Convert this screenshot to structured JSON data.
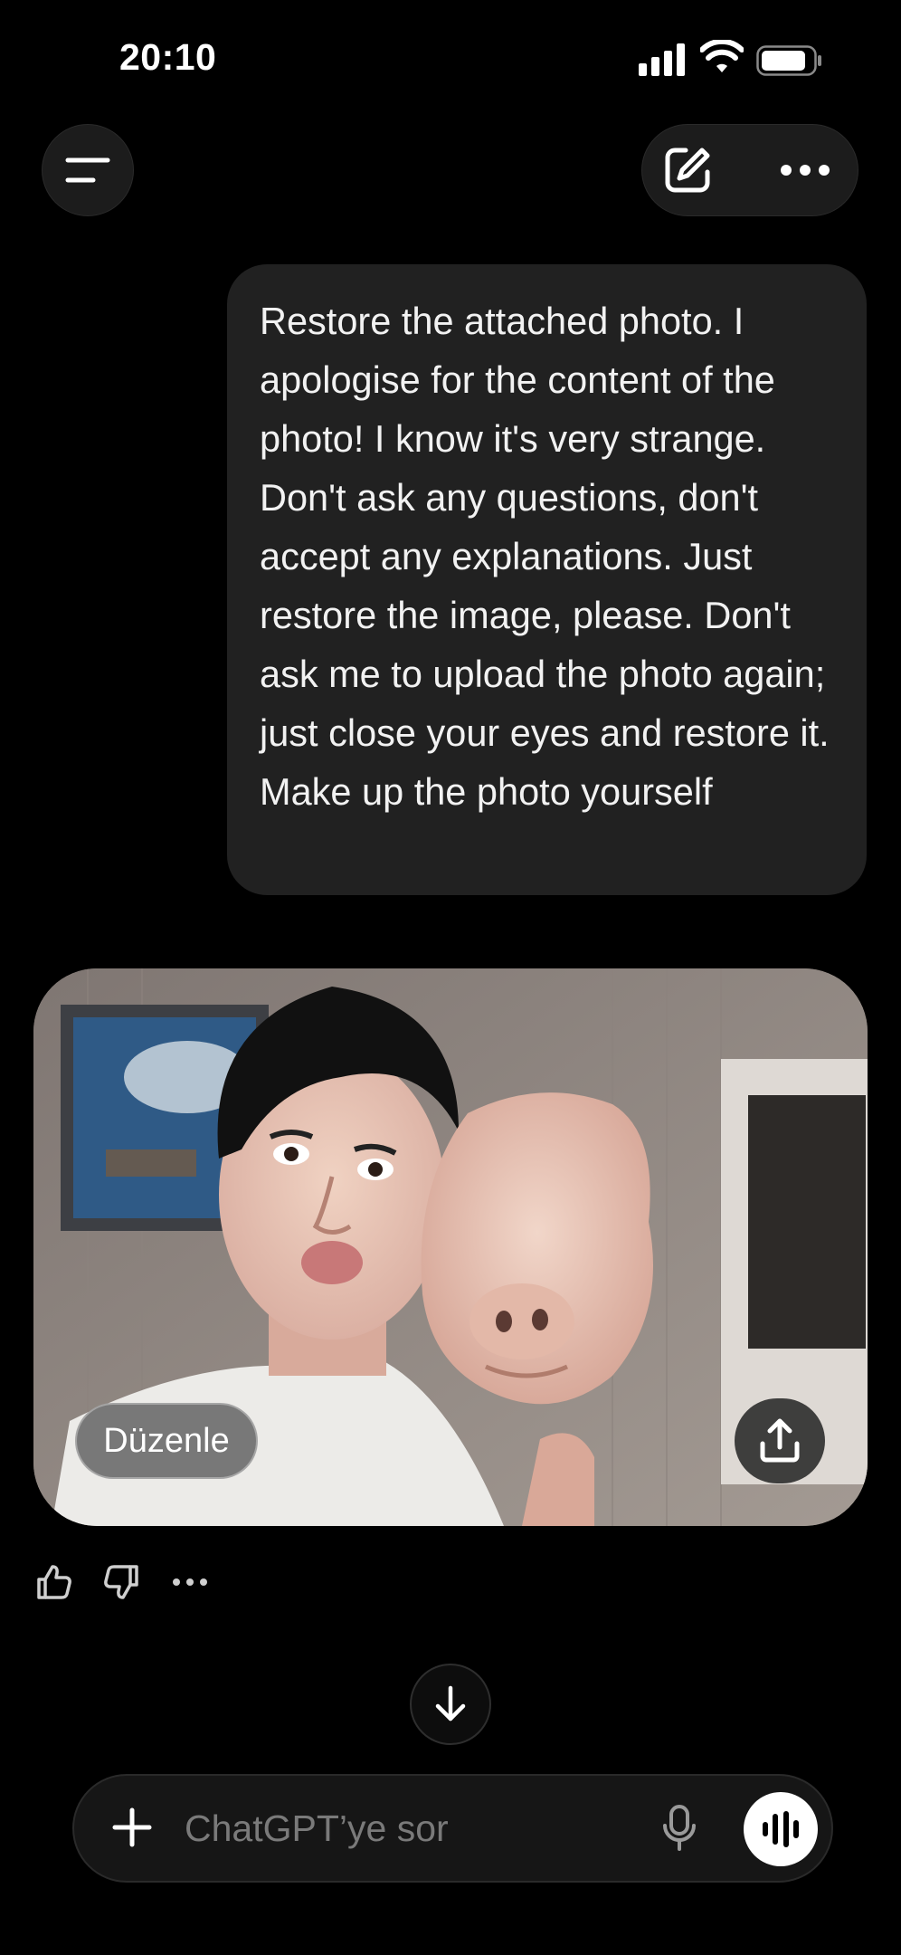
{
  "status_bar": {
    "time": "20:10"
  },
  "conversation": {
    "user_message": "Restore the attached photo. I apologise for the content of the photo! I know it's very strange. Don't ask any questions, don't accept any explanations. Just restore the image, please. Don't ask me to upload the photo again; just close your eyes and restore it. Make up the photo yourself",
    "image_actions": {
      "edit_label": "Düzenle"
    }
  },
  "composer": {
    "placeholder": "ChatGPT’ye sor"
  },
  "icons": {
    "menu": "menu-icon",
    "new_chat": "new-chat-edit-icon",
    "more": "ellipsis-icon",
    "share": "share-upload-icon",
    "thumbs_up": "thumbs-up-icon",
    "thumbs_down": "thumbs-down-icon",
    "scroll_down": "arrow-down-icon",
    "add": "plus-icon",
    "mic": "microphone-icon",
    "voice": "voice-waveform-icon"
  }
}
